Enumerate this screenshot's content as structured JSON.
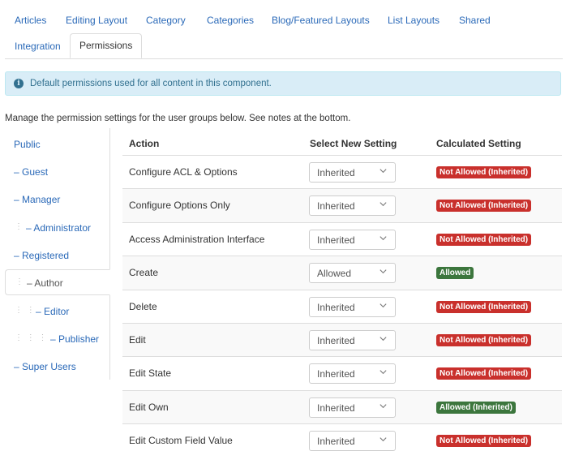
{
  "tabs": [
    {
      "label": "Articles"
    },
    {
      "label": "Editing Layout"
    },
    {
      "label": "Category"
    },
    {
      "label": "Categories"
    },
    {
      "label": "Blog/Featured Layouts"
    },
    {
      "label": "List Layouts"
    },
    {
      "label": "Shared"
    },
    {
      "label": "Integration"
    },
    {
      "label": "Permissions",
      "active": true
    }
  ],
  "alert": {
    "icon": "info-icon",
    "text": "Default permissions used for all content in this component."
  },
  "note": "Manage the permission settings for the user groups below. See notes at the bottom.",
  "groups": [
    {
      "label": "Public",
      "prefix": "",
      "depth": 0
    },
    {
      "label": "– Guest",
      "prefix": "",
      "depth": 1
    },
    {
      "label": "– Manager",
      "prefix": "",
      "depth": 1
    },
    {
      "label": "– Administrator",
      "prefix": "⋮",
      "depth": 2
    },
    {
      "label": "– Registered",
      "prefix": "",
      "depth": 1
    },
    {
      "label": "– Author",
      "prefix": "⋮",
      "depth": 2,
      "active": true
    },
    {
      "label": "– Editor",
      "prefix": "⋮ ⋮",
      "depth": 3
    },
    {
      "label": "– Publisher",
      "prefix": "⋮ ⋮ ⋮",
      "depth": 4
    },
    {
      "label": "– Super Users",
      "prefix": "",
      "depth": 1
    }
  ],
  "table": {
    "headers": {
      "action": "Action",
      "select": "Select New Setting",
      "calculated": "Calculated Setting"
    },
    "rows": [
      {
        "action": "Configure ACL & Options",
        "setting": "Inherited",
        "calc": "Not Allowed (Inherited)",
        "calc_color": "#c9302c"
      },
      {
        "action": "Configure Options Only",
        "setting": "Inherited",
        "calc": "Not Allowed (Inherited)",
        "calc_color": "#c9302c"
      },
      {
        "action": "Access Administration Interface",
        "setting": "Inherited",
        "calc": "Not Allowed (Inherited)",
        "calc_color": "#c9302c"
      },
      {
        "action": "Create",
        "setting": "Allowed",
        "calc": "Allowed",
        "calc_color": "#3c763d"
      },
      {
        "action": "Delete",
        "setting": "Inherited",
        "calc": "Not Allowed (Inherited)",
        "calc_color": "#c9302c"
      },
      {
        "action": "Edit",
        "setting": "Inherited",
        "calc": "Not Allowed (Inherited)",
        "calc_color": "#c9302c"
      },
      {
        "action": "Edit State",
        "setting": "Inherited",
        "calc": "Not Allowed (Inherited)",
        "calc_color": "#c9302c"
      },
      {
        "action": "Edit Own",
        "setting": "Inherited",
        "calc": "Allowed (Inherited)",
        "calc_color": "#3c763d"
      },
      {
        "action": "Edit Custom Field Value",
        "setting": "Inherited",
        "calc": "Not Allowed (Inherited)",
        "calc_color": "#c9302c"
      }
    ]
  },
  "icons": {
    "select": "chevron-down-icon"
  }
}
